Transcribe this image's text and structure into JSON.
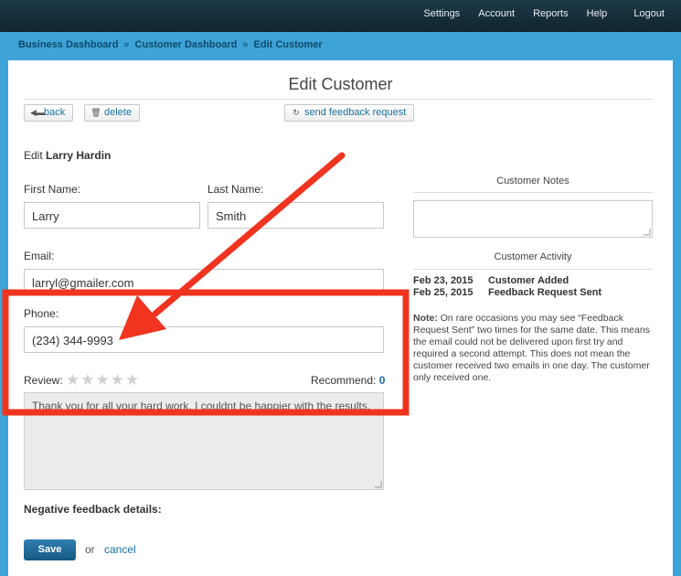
{
  "topnav": {
    "settings": "Settings",
    "account": "Account",
    "reports": "Reports",
    "help": "Help",
    "logout": "Logout"
  },
  "breadcrumb": {
    "item1": "Business Dashboard",
    "item2": "Customer Dashboard",
    "item3": "Edit Customer",
    "sep": "»"
  },
  "page": {
    "title": "Edit Customer"
  },
  "toolbar": {
    "back": "back",
    "delete": "delete",
    "send_feedback": "send feedback request"
  },
  "form": {
    "edit_prefix": "Edit",
    "customer_name": "Larry Hardin",
    "first_name_label": "First Name:",
    "first_name_value": "Larry",
    "last_name_label": "Last Name:",
    "last_name_value": "Smith",
    "email_label": "Email:",
    "email_value": "larryl@gmailer.com",
    "phone_label": "Phone:",
    "phone_value": "(234) 344-9993",
    "review_label": "Review:",
    "review_stars": 0,
    "recommend_label": "Recommend:",
    "recommend_value": "0",
    "review_text": "Thank you for all your hard work. I couldnt be happier with the results.",
    "negative_label": "Negative feedback details:",
    "save": "Save",
    "or": "or",
    "cancel": "cancel"
  },
  "right": {
    "notes_heading": "Customer Notes",
    "activity_heading": "Customer Activity",
    "activity": [
      {
        "date": "Feb 23, 2015",
        "event": "Customer Added"
      },
      {
        "date": "Feb 25, 2015",
        "event": "Feedback Request Sent"
      }
    ],
    "note_label": "Note:",
    "note_text": "On rare occasions you may see “Feedback Request Sent” two times for the same date. This means the email could not be delivered upon first try and required a second attempt. This does not mean the customer received two emails in one day. The customer only received one."
  },
  "colors": {
    "annotation": "#f0341f",
    "link": "#1b6e9c",
    "header": "#173340",
    "crumbbar": "#3ea4d8"
  }
}
